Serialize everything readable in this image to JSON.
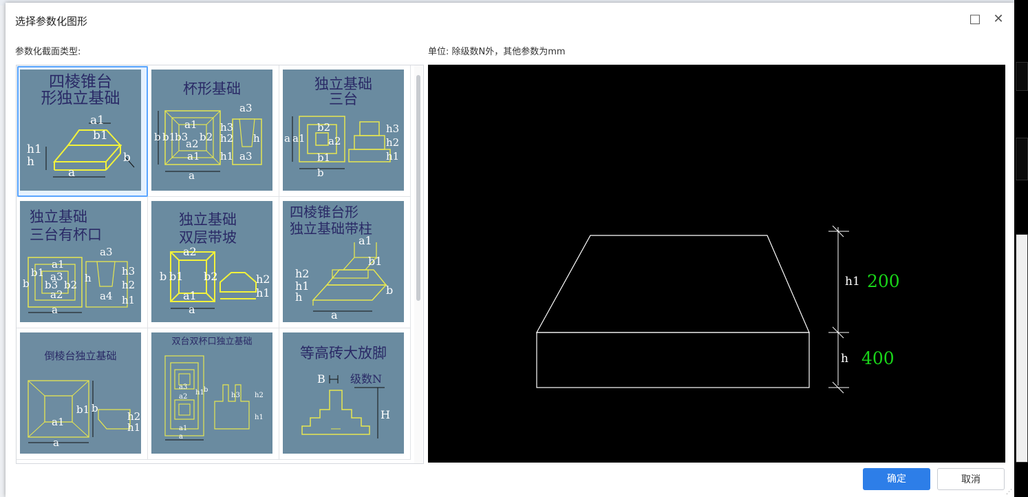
{
  "dialog": {
    "title": "选择参数化图形",
    "maximize_glyph": "□",
    "close_glyph": "✕"
  },
  "left_label": "参数化截面类型:",
  "unit_label": "单位:   除级数N外，其他参数为mm",
  "gallery": {
    "items": [
      {
        "caption": "四棱锥台\n形独立基础",
        "labels": [
          "a1",
          "b1",
          "h1",
          "h",
          "a",
          "b"
        ]
      },
      {
        "caption": "杯形基础",
        "labels": [
          "a3",
          "a2",
          "a1",
          "b",
          "b",
          "b1",
          "b3",
          "b2",
          "h3",
          "h2",
          "h1",
          "h",
          "a3",
          "a"
        ]
      },
      {
        "caption": "独立基础\n三台",
        "labels": [
          "b2",
          "a2",
          "a",
          "a1",
          "b1",
          "b",
          "h3",
          "h2",
          "h1"
        ]
      },
      {
        "caption": "独立基础\n三台有杯口",
        "labels": [
          "a1",
          "a2",
          "a3",
          "b1",
          "b3",
          "b2",
          "b",
          "a",
          "a3",
          "h3",
          "h2",
          "h1",
          "a4",
          "h"
        ]
      },
      {
        "caption": "独立基础\n双层带坡",
        "labels": [
          "a2",
          "b",
          "b1",
          "b2",
          "a1",
          "a",
          "h2",
          "h1"
        ]
      },
      {
        "caption": "四棱锥台形\n独立基础带柱",
        "labels": [
          "a1",
          "b1",
          "h2",
          "h1",
          "h",
          "a",
          "b"
        ]
      },
      {
        "caption": "倒棱台独立基础",
        "labels": [
          "b1",
          "a1",
          "a",
          "b",
          "h2",
          "h1"
        ]
      },
      {
        "caption": "双台双杯口独立基础",
        "labels": [
          "a3",
          "a2",
          "a1",
          "a",
          "h1",
          "b",
          "h3",
          "h2",
          "h1"
        ]
      },
      {
        "caption": "等高砖大放脚",
        "labels": [
          "B",
          "级数N",
          "H"
        ]
      }
    ]
  },
  "preview": {
    "dims": [
      {
        "name": "h1",
        "value": "200"
      },
      {
        "name": "h",
        "value": "400"
      }
    ]
  },
  "buttons": {
    "ok": "确定",
    "cancel": "取消"
  },
  "colors": {
    "accent": "#2d7ee8",
    "thumb_bg": "#6a8ba0",
    "dim_value": "#19d419",
    "outline": "#ffffff"
  }
}
